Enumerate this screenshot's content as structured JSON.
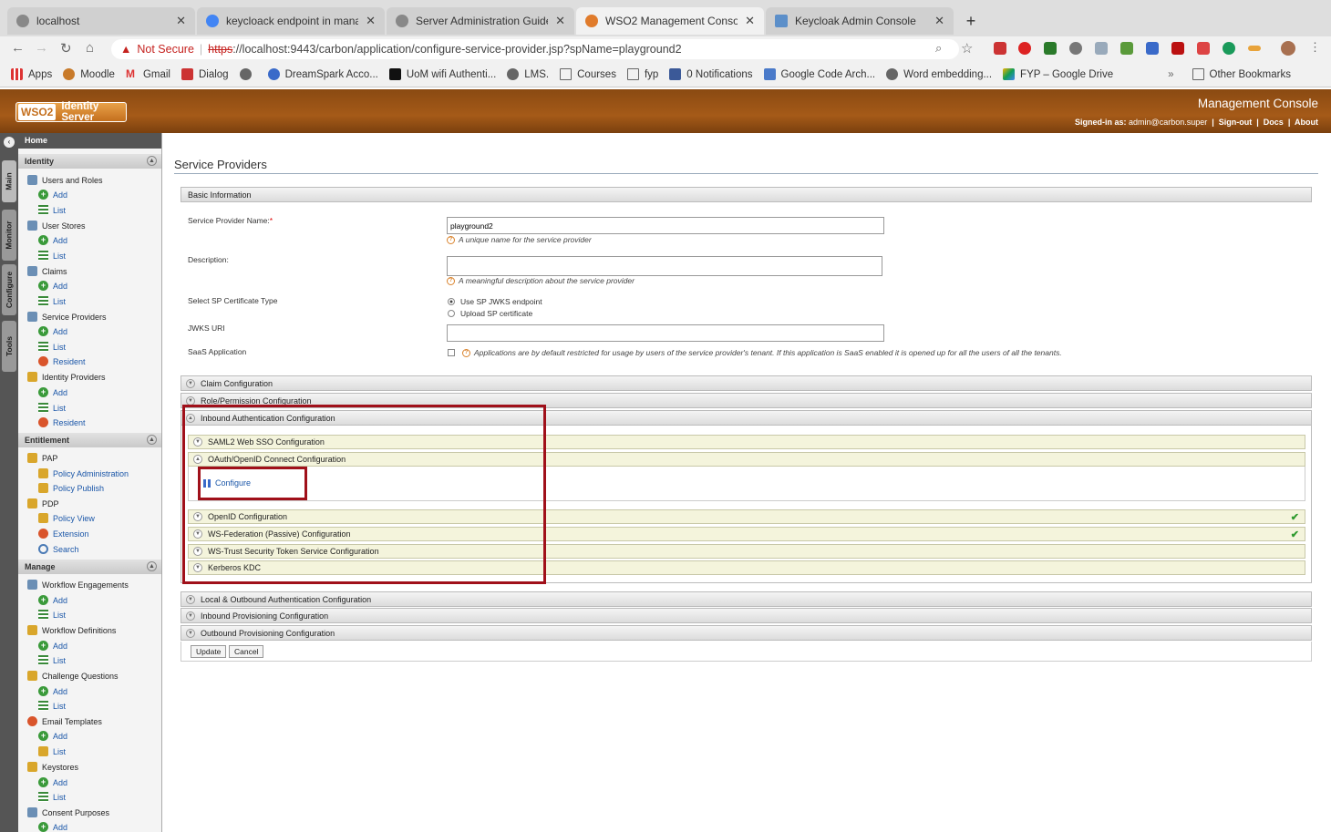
{
  "browser": {
    "tabs": [
      {
        "title": "localhost"
      },
      {
        "title": "keycloack endpoint in manage"
      },
      {
        "title": "Server Administration Guide"
      },
      {
        "title": "WSO2 Management Console"
      },
      {
        "title": "Keycloak Admin Console"
      }
    ],
    "address": {
      "security": "Not Secure",
      "scheme": "https",
      "url": "://localhost:9443/carbon/application/configure-service-provider.jsp?spName=playground2"
    },
    "bookmarks": [
      "Apps",
      "Moodle",
      "Gmail",
      "Dialog",
      "",
      "DreamSpark Acco...",
      "UoM wifi Authenti...",
      "LMS.",
      "Courses",
      "fyp",
      "0 Notifications",
      "Google Code Arch...",
      "Word embedding...",
      "FYP – Google Drive"
    ],
    "bookmarks_more": "»",
    "other_bookmarks": "Other Bookmarks"
  },
  "header": {
    "logo_w": "WSO2",
    "logo_text": "Identity Server",
    "console_title": "Management Console",
    "signed_label": "Signed-in as:",
    "user": "admin@carbon.super",
    "signout": "Sign-out",
    "docs": "Docs",
    "about": "About"
  },
  "vtabs": [
    "Main",
    "Monitor",
    "Configure",
    "Tools"
  ],
  "sidebar": {
    "home": "Home",
    "identity": "Identity",
    "users_roles": "Users and Roles",
    "user_stores": "User Stores",
    "claims": "Claims",
    "service_providers": "Service Providers",
    "identity_providers": "Identity Providers",
    "entitlement": "Entitlement",
    "pap": "PAP",
    "policy_admin": "Policy Administration",
    "policy_publish": "Policy Publish",
    "pdp": "PDP",
    "policy_view": "Policy View",
    "extension": "Extension",
    "search": "Search",
    "manage": "Manage",
    "workflow_eng": "Workflow Engagements",
    "workflow_def": "Workflow Definitions",
    "challenge": "Challenge Questions",
    "email": "Email Templates",
    "keystores": "Keystores",
    "consent": "Consent Purposes",
    "add": "Add",
    "list": "List",
    "resident": "Resident"
  },
  "main": {
    "title": "Service Providers",
    "basic_info": "Basic Information",
    "sp_name_label": "Service Provider Name:",
    "required": "*",
    "sp_name_value": "playground2",
    "sp_name_hint": "A unique name for the service provider",
    "desc_label": "Description:",
    "desc_hint": "A meaningful description about the service provider",
    "cert_label": "Select SP Certificate Type",
    "cert_opt1": "Use SP JWKS endpoint",
    "cert_opt2": "Upload SP certificate",
    "jwks_label": "JWKS URI",
    "saas_label": "SaaS Application",
    "saas_hint": "Applications are by default restricted for usage by users of the service provider's tenant. If this application is SaaS enabled it is opened up for all the users of all the tenants.",
    "claim_cfg": "Claim Configuration",
    "role_cfg": "Role/Permission Configuration",
    "inbound_cfg": "Inbound Authentication Configuration",
    "saml": "SAML2 Web SSO Configuration",
    "oauth": "OAuth/OpenID Connect Configuration",
    "configure": "Configure",
    "openid": "OpenID Configuration",
    "wsfed": "WS-Federation (Passive) Configuration",
    "wstrust": "WS-Trust Security Token Service Configuration",
    "kerberos": "Kerberos KDC",
    "local_outbound": "Local & Outbound Authentication Configuration",
    "inbound_prov": "Inbound Provisioning Configuration",
    "outbound_prov": "Outbound Provisioning Configuration",
    "update": "Update",
    "cancel": "Cancel"
  },
  "colors": {
    "header": "#a55a18",
    "highlight": "#a0101a",
    "check": "#2e9a2e"
  }
}
